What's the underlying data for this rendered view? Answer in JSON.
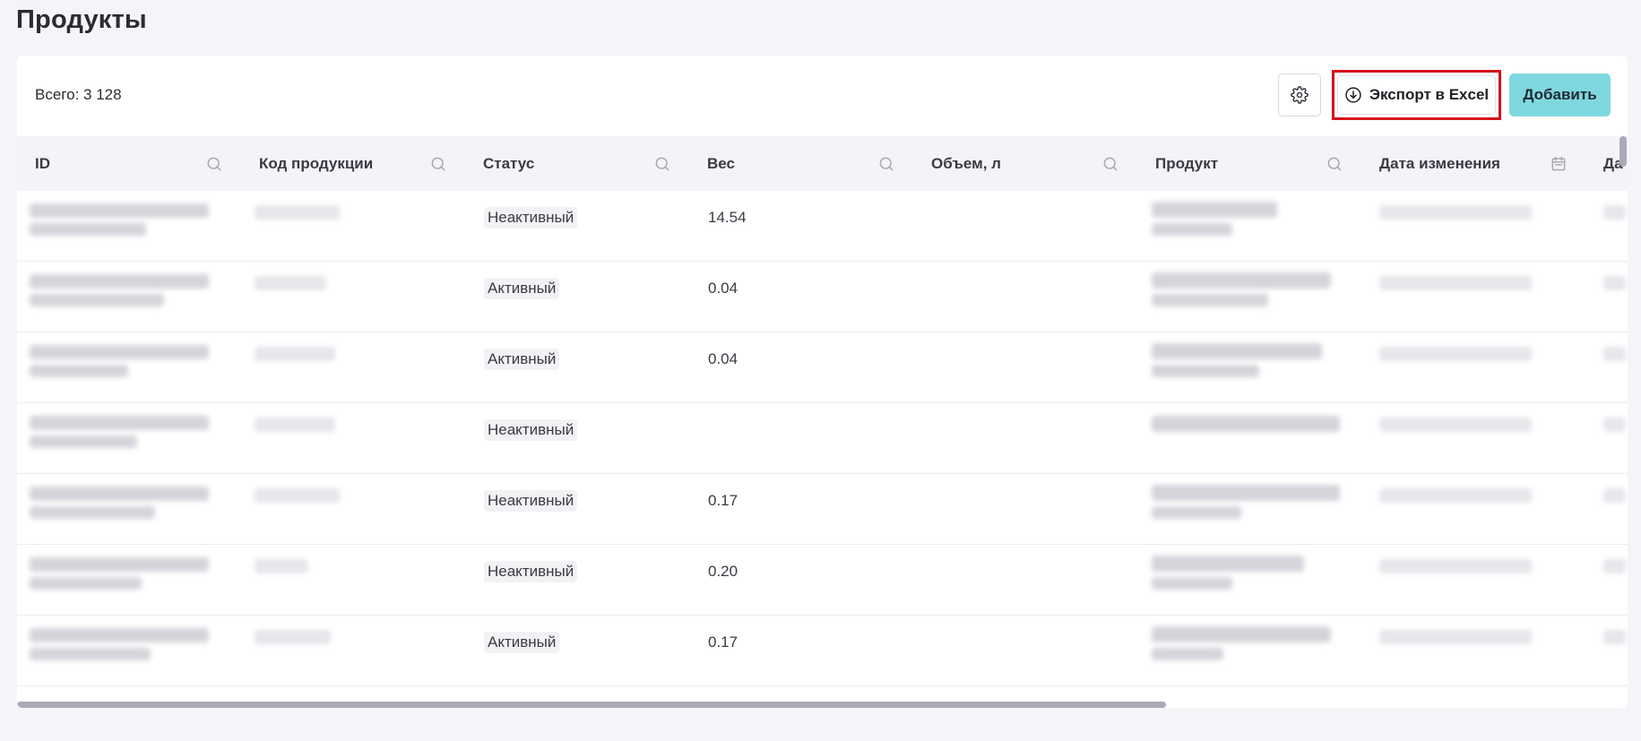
{
  "page": {
    "title": "Продукты"
  },
  "toolbar": {
    "total_label": "Всего: 3 128",
    "settings_icon": "gear-icon",
    "export_label": "Экспорт в Excel",
    "export_icon": "download-circle-icon",
    "add_label": "Добавить"
  },
  "colors": {
    "add_button": "#7fd8df",
    "highlight_border": "#d8101c",
    "header_bg": "#f4f4f8",
    "page_bg": "#f5f5f9"
  },
  "table": {
    "columns": [
      {
        "label": "ID",
        "icon": "search-icon"
      },
      {
        "label": "Код продукции",
        "icon": "search-icon"
      },
      {
        "label": "Статус",
        "icon": "search-icon"
      },
      {
        "label": "Вес",
        "icon": "search-icon"
      },
      {
        "label": "Объем, л",
        "icon": "search-icon"
      },
      {
        "label": "Продукт",
        "icon": "search-icon"
      },
      {
        "label": "Дата изменения",
        "icon": "calendar-icon"
      },
      {
        "label": "Да"
      }
    ],
    "rows": [
      {
        "status": "Неактивный",
        "weight": "14.54",
        "volume": ""
      },
      {
        "status": "Активный",
        "weight": "0.04",
        "volume": ""
      },
      {
        "status": "Активный",
        "weight": "0.04",
        "volume": ""
      },
      {
        "status": "Неактивный",
        "weight": "",
        "volume": ""
      },
      {
        "status": "Неактивный",
        "weight": "0.17",
        "volume": ""
      },
      {
        "status": "Неактивный",
        "weight": "0.20",
        "volume": ""
      },
      {
        "status": "Активный",
        "weight": "0.17",
        "volume": ""
      }
    ]
  }
}
